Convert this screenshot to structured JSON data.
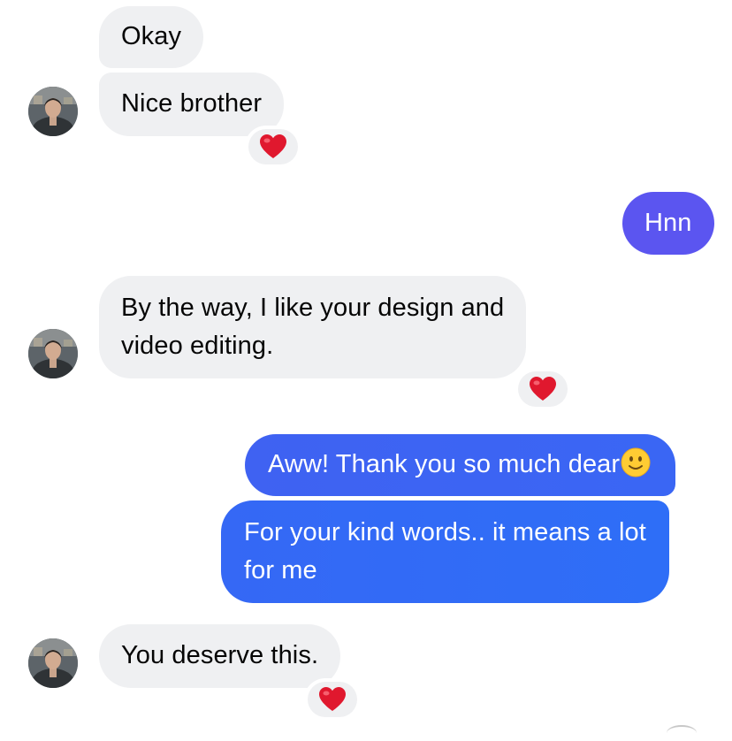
{
  "conversation": {
    "messages": [
      {
        "direction": "incoming",
        "text": "Okay"
      },
      {
        "direction": "incoming",
        "text": "Nice brother",
        "reaction": "red-heart"
      },
      {
        "direction": "outgoing",
        "text": "Hnn"
      },
      {
        "direction": "incoming",
        "lines": [
          "By the way, I like your design and",
          "video editing."
        ],
        "reaction": "red-heart"
      },
      {
        "direction": "outgoing",
        "text": "Aww! Thank you so much dear",
        "emoji": "slightly-smiling-face"
      },
      {
        "direction": "outgoing",
        "lines": [
          "For your kind words.. it means a lot",
          "for me"
        ]
      },
      {
        "direction": "incoming",
        "text": "You deserve this.",
        "reaction": "red-heart"
      }
    ]
  },
  "colors": {
    "incoming_bubble": "#eff0f2",
    "incoming_text": "#050505",
    "outgoing_gradient_purple": "#5b55f0",
    "outgoing_gradient_blue": "#2f6cf6",
    "outgoing_text": "#ffffff",
    "reaction_heart": "#e0182e"
  }
}
